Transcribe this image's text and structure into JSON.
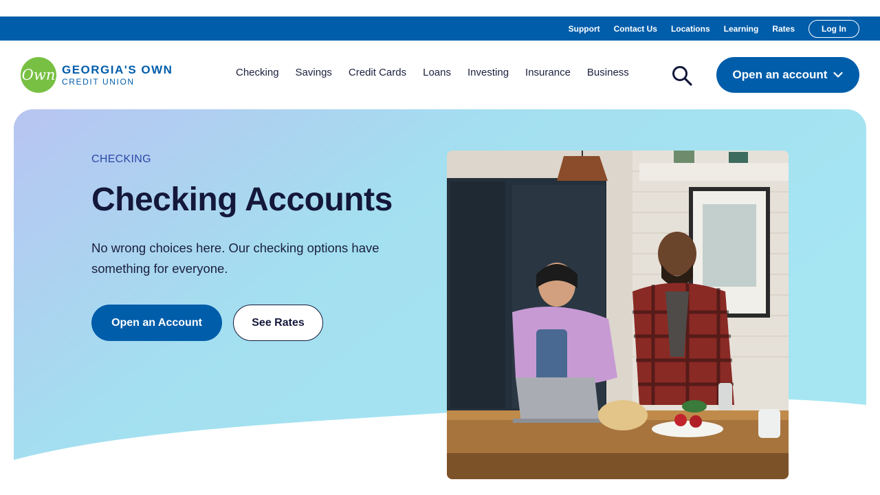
{
  "utility_nav": {
    "links": [
      "Support",
      "Contact Us",
      "Locations",
      "Learning",
      "Rates"
    ],
    "login_label": "Log In"
  },
  "brand": {
    "logo_mark": "Own",
    "name_line1": "GEORGIA'S OWN",
    "name_line2": "CREDIT UNION"
  },
  "main_nav": {
    "items": [
      "Checking",
      "Savings",
      "Credit Cards",
      "Loans",
      "Investing",
      "Insurance",
      "Business"
    ],
    "search_icon": "search-icon",
    "open_account_label": "Open an account"
  },
  "hero": {
    "eyebrow": "CHECKING",
    "title": "Checking Accounts",
    "description": "No wrong choices here. Our checking options have something for everyone.",
    "primary_cta": "Open an Account",
    "secondary_cta": "See Rates"
  },
  "colors": {
    "brand_blue": "#005daa",
    "brand_green": "#78c043",
    "navy_text": "#14183a",
    "eyebrow_blue": "#2b48a8"
  }
}
